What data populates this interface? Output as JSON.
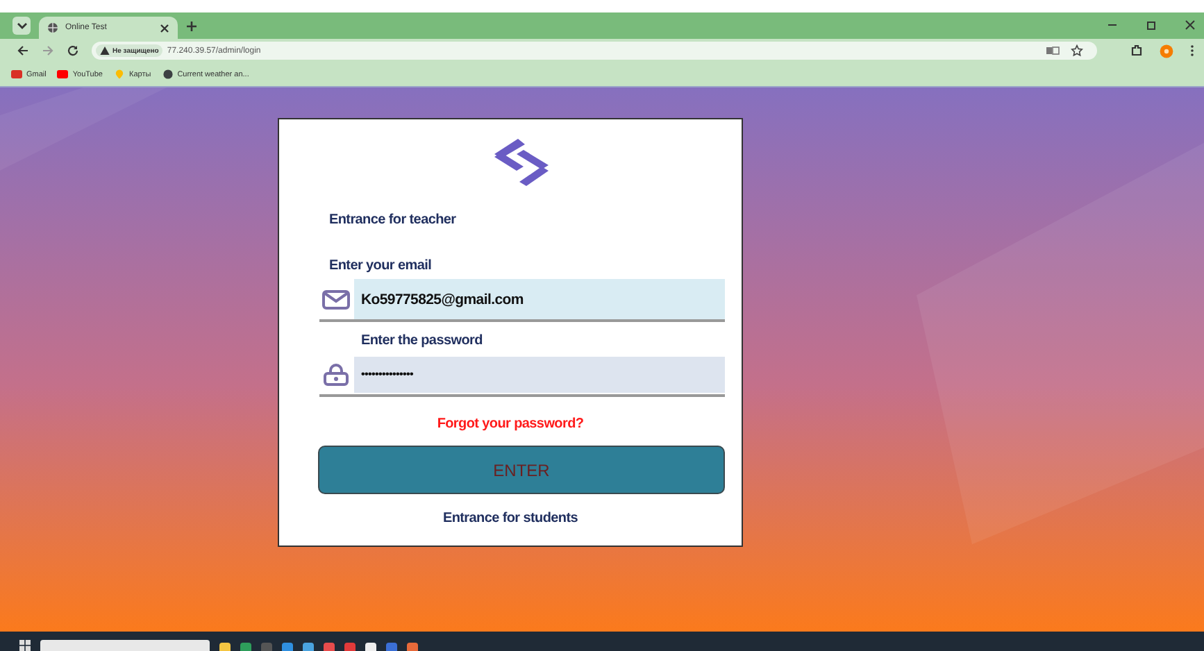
{
  "browser": {
    "tab": {
      "title": "Online Test",
      "selected": true
    },
    "address": {
      "security": "Не защищено",
      "url": "77.240.39.57/admin/login"
    },
    "bookmarks": [
      {
        "label": "Gmail",
        "kind": "gmail"
      },
      {
        "label": "YouTube",
        "kind": "youtube"
      },
      {
        "label": "Карты",
        "kind": "maps"
      },
      {
        "label": "Current weather an...",
        "kind": "globe"
      }
    ]
  },
  "login": {
    "heading": "Entrance for teacher",
    "email": {
      "label": "Enter your email",
      "value": "Ko59775825@gmail.com"
    },
    "password": {
      "label": "Enter the password",
      "value": "•••••••••••••••"
    },
    "forgot": "Forgot your password?",
    "submit": "ENTER",
    "students": "Entrance for students"
  }
}
